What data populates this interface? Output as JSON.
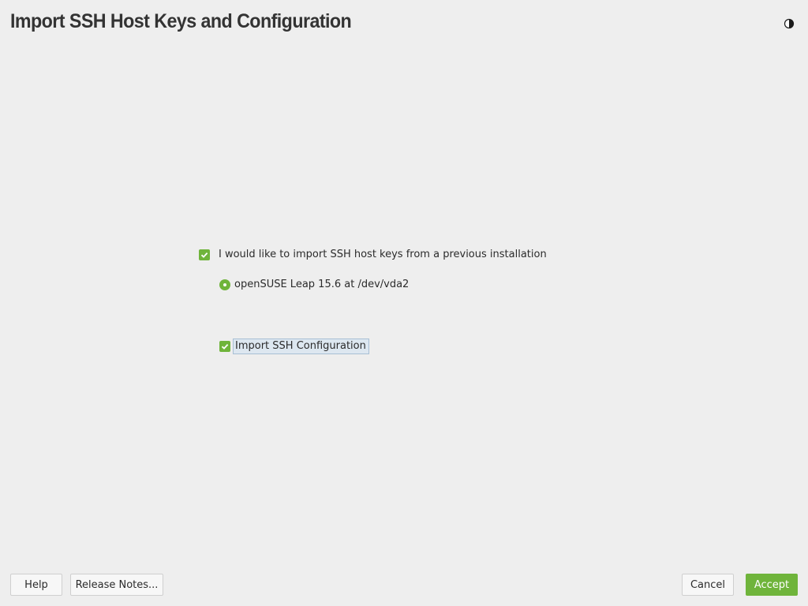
{
  "header": {
    "title": "Import SSH Host Keys and Configuration",
    "theme_toggle_icon": "half-moon-icon"
  },
  "options": {
    "import_keys": {
      "label": "I would like to import SSH host keys from a previous installation",
      "checked": true
    },
    "source": {
      "label": "openSUSE Leap 15.6 at /dev/vda2",
      "selected": true
    },
    "import_config": {
      "label": "Import SSH Configuration",
      "checked": true
    }
  },
  "footer": {
    "help_label": "Help",
    "release_notes_label": "Release Notes...",
    "cancel_label": "Cancel",
    "accept_label": "Accept"
  },
  "colors": {
    "accent": "#6fb43b",
    "background": "#eeeeee"
  }
}
